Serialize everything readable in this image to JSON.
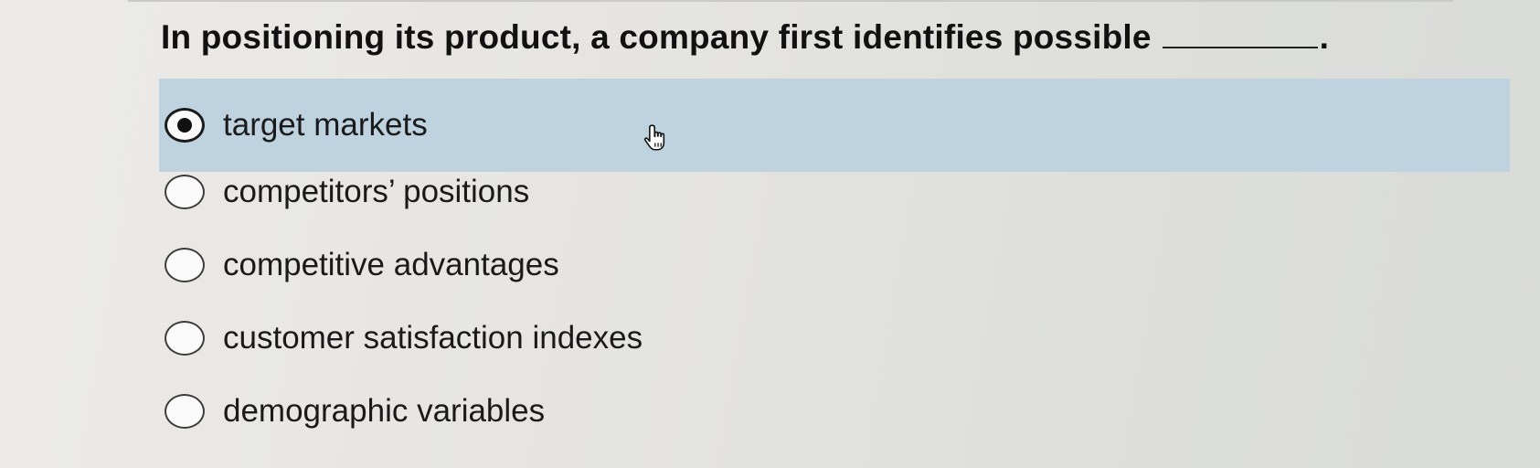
{
  "question": {
    "text": "In positioning its product, a company first identifies possible",
    "period": "."
  },
  "options": [
    {
      "label": "target markets",
      "selected": true
    },
    {
      "label": "competitors’ positions",
      "selected": false
    },
    {
      "label": "competitive advantages",
      "selected": false
    },
    {
      "label": "customer satisfaction indexes",
      "selected": false
    },
    {
      "label": "demographic variables",
      "selected": false
    }
  ],
  "cursor": {
    "icon": "hand-pointer-icon"
  },
  "colors": {
    "selected_row": "#bed2df",
    "background": "#e6e5e1"
  }
}
